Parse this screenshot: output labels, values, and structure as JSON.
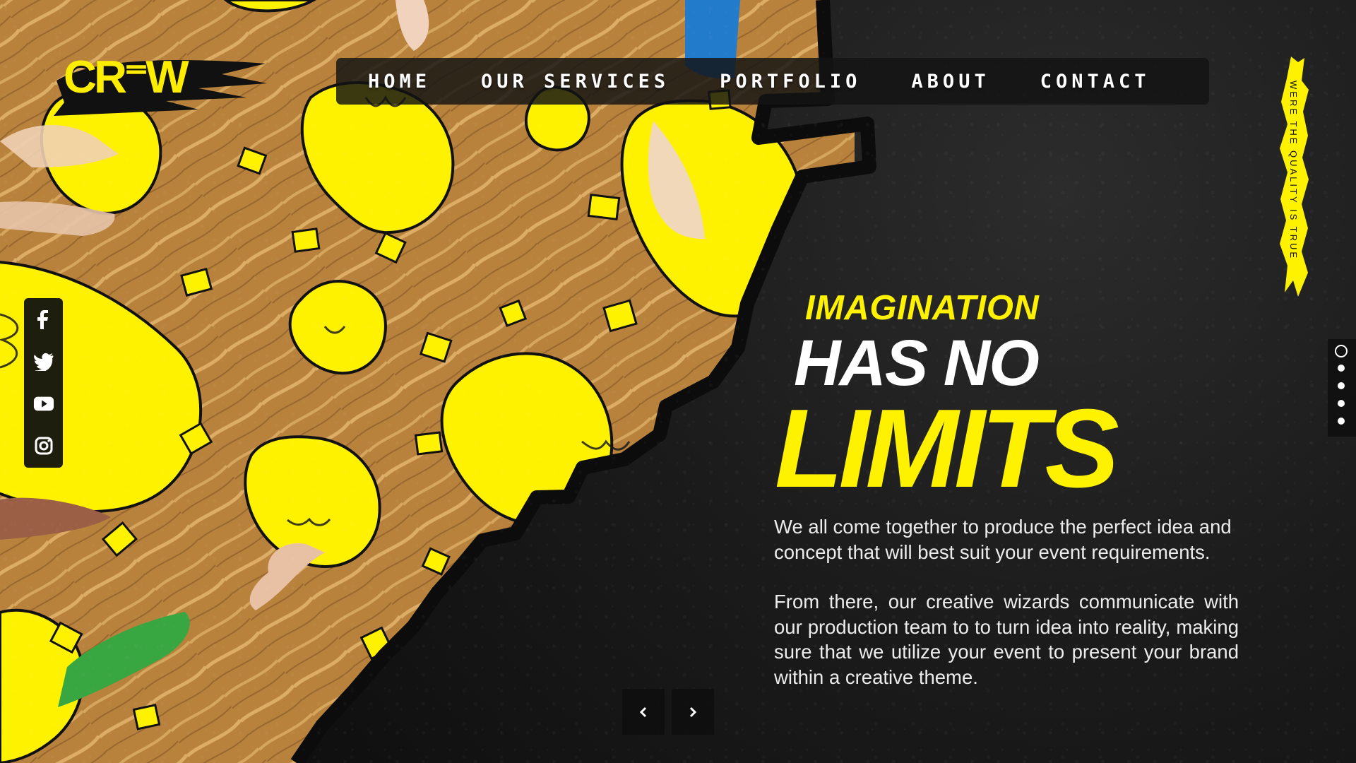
{
  "brand": {
    "name": "CR⁼W",
    "accent_color": "#fff200",
    "background_color": "#151515"
  },
  "navigation": {
    "items": [
      {
        "label": "HOME"
      },
      {
        "label": "OUR SERVICES"
      },
      {
        "label": "PORTFOLIO"
      },
      {
        "label": "ABOUT"
      },
      {
        "label": "CONTACT"
      }
    ]
  },
  "side_tagline": {
    "text": "WERE THE QUALITY IS TRUE"
  },
  "social": {
    "icons": [
      {
        "name": "facebook-icon"
      },
      {
        "name": "twitter-icon"
      },
      {
        "name": "youtube-icon"
      },
      {
        "name": "instagram-icon"
      }
    ]
  },
  "hero": {
    "line_one": "IMAGINATION",
    "line_two": "HAS NO",
    "line_three": "LIMITS",
    "paragraphs": [
      "We all come together to produce the perfect idea and concept that will best suit your event requirements.",
      "From there, our creative wizards communicate with our production team to to turn idea into reality, making sure that we utilize your event to present your brand within a creative theme."
    ]
  },
  "slider": {
    "previous_icon": "chevron-left-icon",
    "next_icon": "chevron-right-icon",
    "total_slides": 5,
    "active_slide": 1
  }
}
